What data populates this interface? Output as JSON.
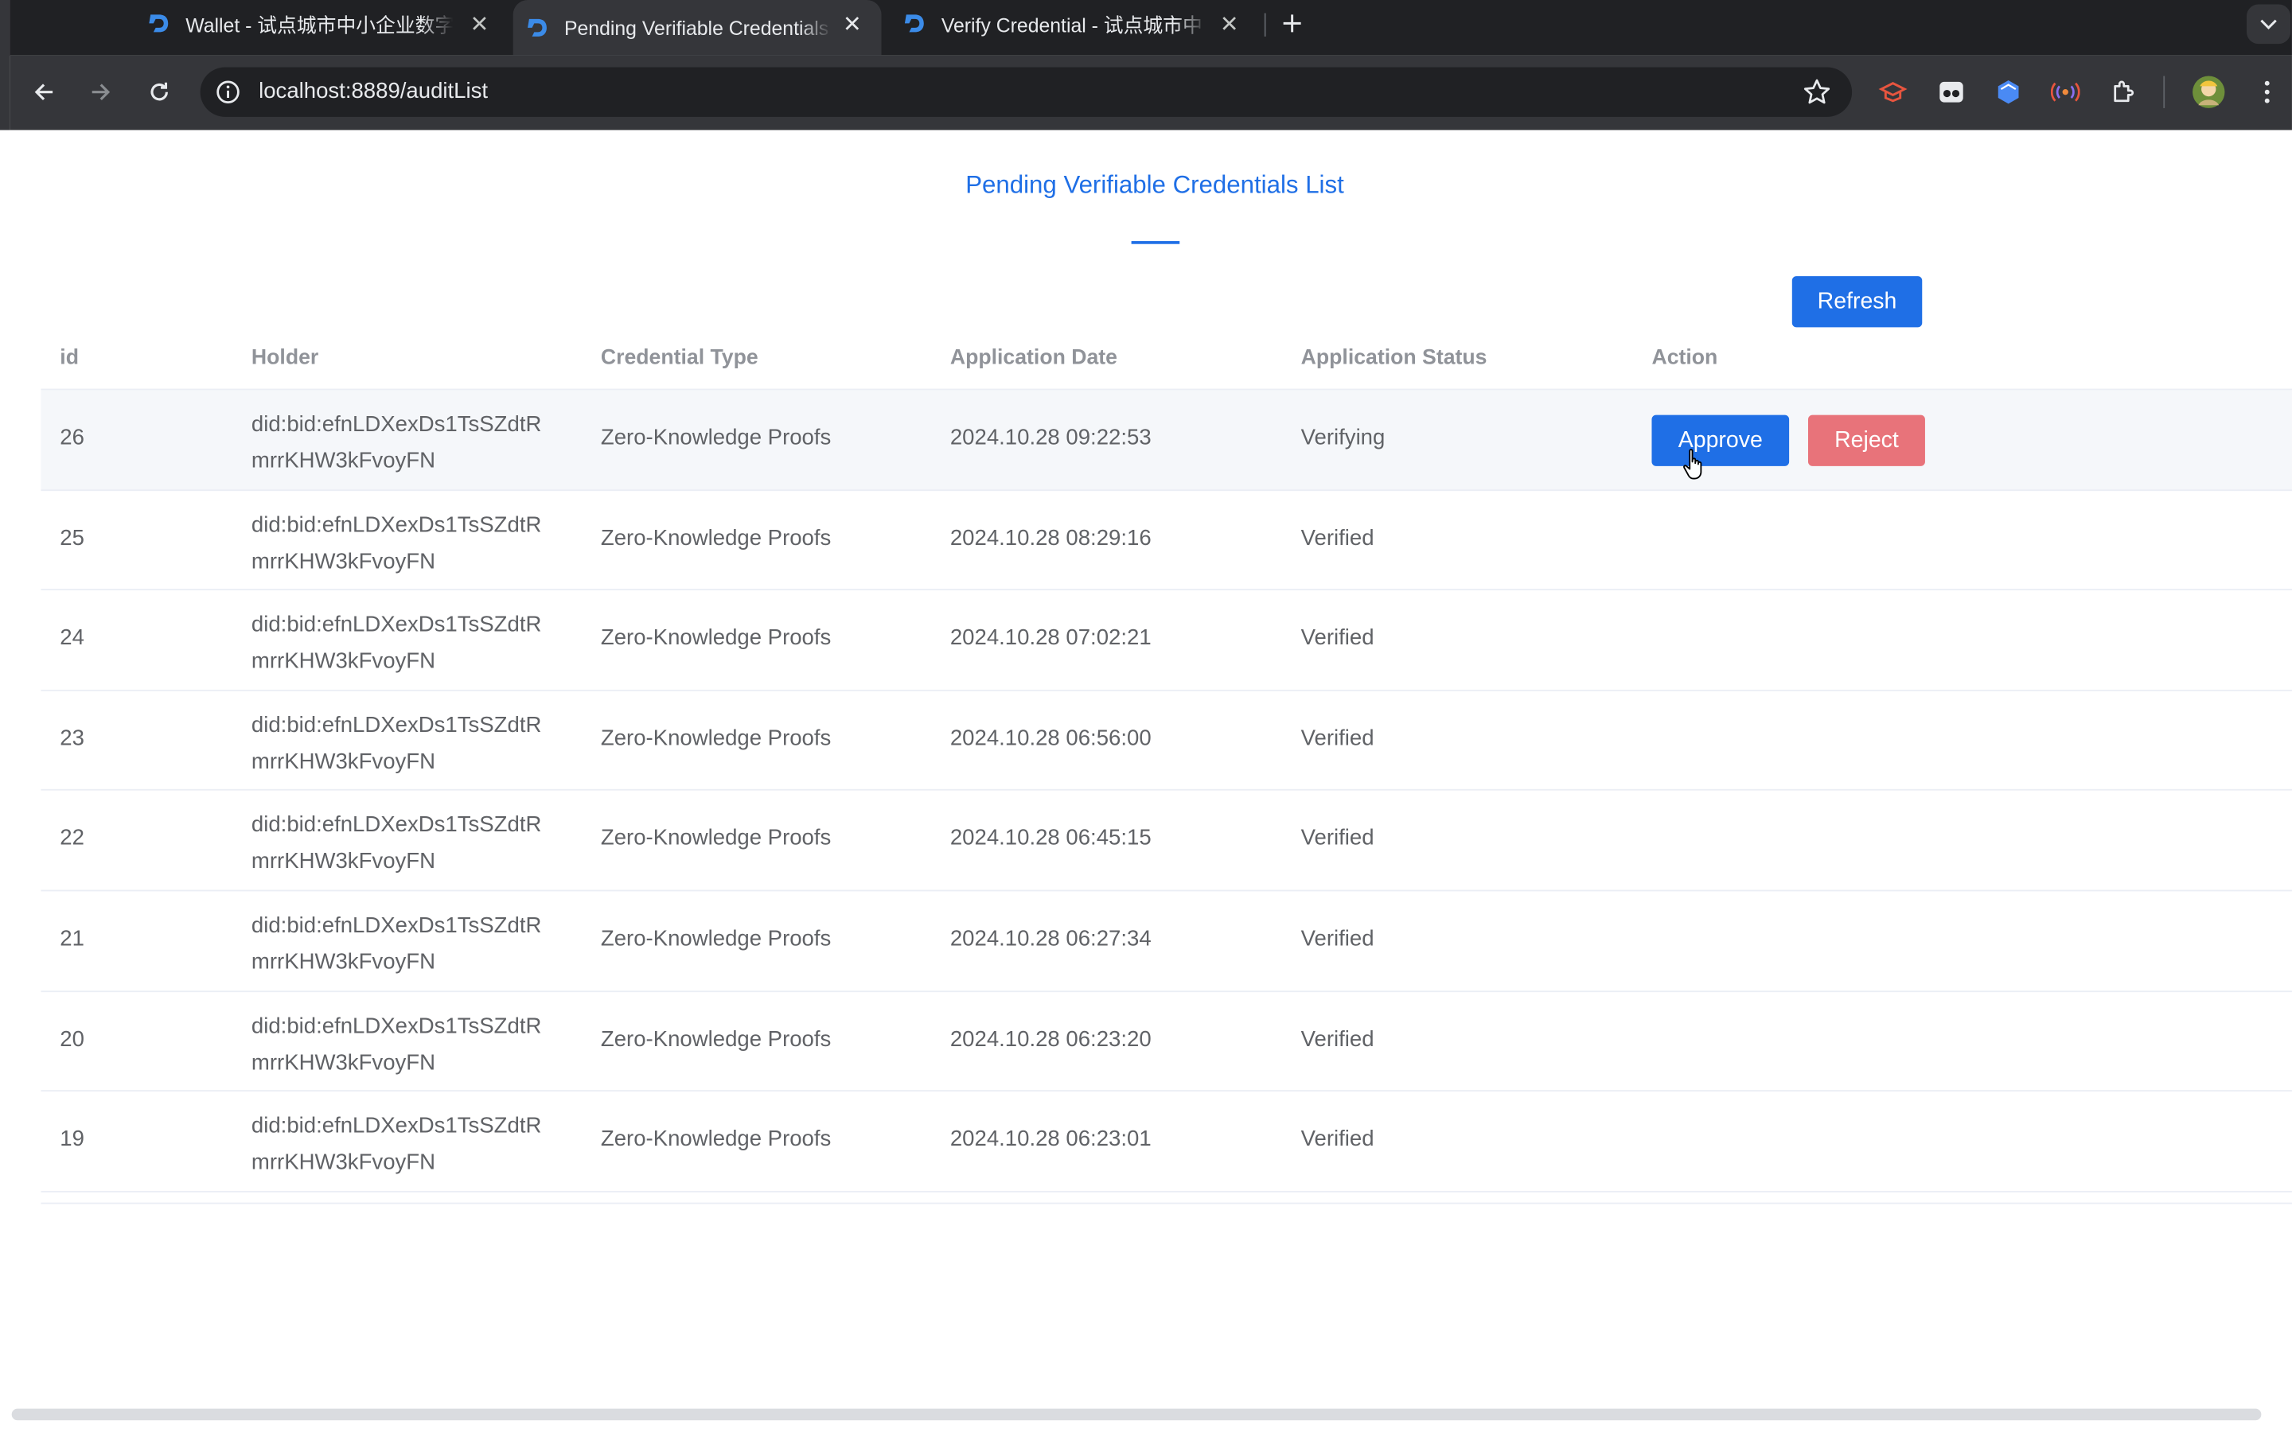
{
  "browser": {
    "tabs": [
      {
        "title": "Wallet - 试点城市中小企业数字",
        "active": false
      },
      {
        "title": "Pending Verifiable Credentials",
        "active": true
      },
      {
        "title": "Verify Credential - 试点城市中",
        "active": false
      }
    ],
    "url": "localhost:8889/auditList"
  },
  "page": {
    "title": "Pending Verifiable Credentials List",
    "refresh_label": "Refresh",
    "columns": [
      "id",
      "Holder",
      "Credential Type",
      "Application Date",
      "Application Status",
      "Action"
    ],
    "approve_label": "Approve",
    "reject_label": "Reject",
    "rows": [
      {
        "id": "26",
        "holder": "did:bid:efnLDXexDs1TsSZdtRmrrKHW3kFvoyFN",
        "holder_line1": "did:bid:efnLDXexDs1TsSZdtR",
        "holder_line2": "mrrKHW3kFvoyFN",
        "type": "Zero-Knowledge Proofs",
        "date": "2024.10.28 09:22:53",
        "status": "Verifying"
      },
      {
        "id": "25",
        "holder": "did:bid:efnLDXexDs1TsSZdtRmrrKHW3kFvoyFN",
        "holder_line1": "did:bid:efnLDXexDs1TsSZdtR",
        "holder_line2": "mrrKHW3kFvoyFN",
        "type": "Zero-Knowledge Proofs",
        "date": "2024.10.28 08:29:16",
        "status": "Verified"
      },
      {
        "id": "24",
        "holder": "did:bid:efnLDXexDs1TsSZdtRmrrKHW3kFvoyFN",
        "holder_line1": "did:bid:efnLDXexDs1TsSZdtR",
        "holder_line2": "mrrKHW3kFvoyFN",
        "type": "Zero-Knowledge Proofs",
        "date": "2024.10.28 07:02:21",
        "status": "Verified"
      },
      {
        "id": "23",
        "holder": "did:bid:efnLDXexDs1TsSZdtRmrrKHW3kFvoyFN",
        "holder_line1": "did:bid:efnLDXexDs1TsSZdtR",
        "holder_line2": "mrrKHW3kFvoyFN",
        "type": "Zero-Knowledge Proofs",
        "date": "2024.10.28 06:56:00",
        "status": "Verified"
      },
      {
        "id": "22",
        "holder": "did:bid:efnLDXexDs1TsSZdtRmrrKHW3kFvoyFN",
        "holder_line1": "did:bid:efnLDXexDs1TsSZdtR",
        "holder_line2": "mrrKHW3kFvoyFN",
        "type": "Zero-Knowledge Proofs",
        "date": "2024.10.28 06:45:15",
        "status": "Verified"
      },
      {
        "id": "21",
        "holder": "did:bid:efnLDXexDs1TsSZdtRmrrKHW3kFvoyFN",
        "holder_line1": "did:bid:efnLDXexDs1TsSZdtR",
        "holder_line2": "mrrKHW3kFvoyFN",
        "type": "Zero-Knowledge Proofs",
        "date": "2024.10.28 06:27:34",
        "status": "Verified"
      },
      {
        "id": "20",
        "holder": "did:bid:efnLDXexDs1TsSZdtRmrrKHW3kFvoyFN",
        "holder_line1": "did:bid:efnLDXexDs1TsSZdtR",
        "holder_line2": "mrrKHW3kFvoyFN",
        "type": "Zero-Knowledge Proofs",
        "date": "2024.10.28 06:23:20",
        "status": "Verified"
      },
      {
        "id": "19",
        "holder": "did:bid:efnLDXexDs1TsSZdtRmrrKHW3kFvoyFN",
        "holder_line1": "did:bid:efnLDXexDs1TsSZdtR",
        "holder_line2": "mrrKHW3kFvoyFN",
        "type": "Zero-Knowledge Proofs",
        "date": "2024.10.28 06:23:01",
        "status": "Verified"
      }
    ]
  },
  "colors": {
    "accent": "#1f6fe6",
    "reject": "#e8737a",
    "chrome_dark": "#202124",
    "chrome_toolbar": "#35363a"
  },
  "icons": [
    "app-favicon-icon",
    "close-icon",
    "plus-icon",
    "chevron-down-icon",
    "back-icon",
    "forward-icon",
    "reload-icon",
    "info-icon",
    "star-icon",
    "extension-icon",
    "puzzle-icon",
    "avatar",
    "kebab-menu-icon",
    "cursor-icon"
  ]
}
